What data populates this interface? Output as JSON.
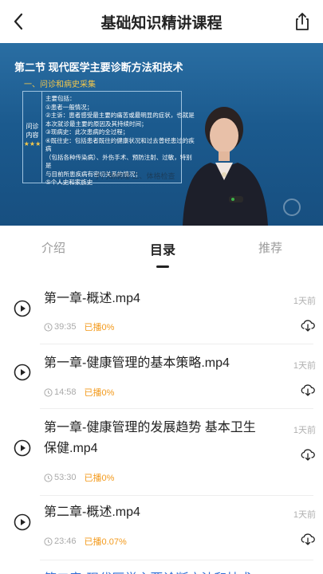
{
  "header": {
    "title": "基础知识精讲课程",
    "back_icon": "chevron-left-icon",
    "share_icon": "share-icon"
  },
  "video": {
    "slide_title": "第二节   现代医学主要诊断方法和技术",
    "slide_subtitle": "一、问诊和病史采集",
    "box_label_line1": "问诊",
    "box_label_line2": "内容",
    "box_label_stars": "★★★",
    "slide_lines": [
      "主要包括：",
      "①患者一般情况；",
      "②主诉：患者感受最主要的痛苦或最明显的症状，也就是",
      "本次就诊最主要的原因及其持续时间；",
      "③现病史：此次患病的全过程；",
      "④既往史：包括患者既往的健康状况和过去曾经患过的疾病",
      "（包括各种传染病）、外伤手术、预防注射、过敏，特别是",
      "与目前所患疾病有密切关系的情况；",
      "⑤个人史和家族史"
    ],
    "slide_overlay": "子门胡病理  二、体格检查"
  },
  "tabs": {
    "intro": "介绍",
    "catalog": "目录",
    "recommend": "推荐",
    "active": "catalog"
  },
  "items": [
    {
      "title": "第一章-概述.mp4",
      "date": "1天前",
      "duration": "39:35",
      "played": "已播0%"
    },
    {
      "title": "第一章-健康管理的基本策略.mp4",
      "date": "1天前",
      "duration": "14:58",
      "played": "已播0%"
    },
    {
      "title": "第一章-健康管理的发展趋势 基本卫生保健.mp4",
      "date": "1天前",
      "duration": "53:30",
      "played": "已播0%"
    },
    {
      "title": "第二章-概述.mp4",
      "date": "1天前",
      "duration": "23:46",
      "played": "已播0.07%"
    }
  ],
  "partial_item_title": "第二章-现代医学主要诊断方法和技术",
  "colors": {
    "accent_orange": "#f39a1c",
    "video_blue": "#1c5a8c",
    "slide_highlight": "#f5c84b",
    "partial_blue": "#2f6fd6"
  }
}
